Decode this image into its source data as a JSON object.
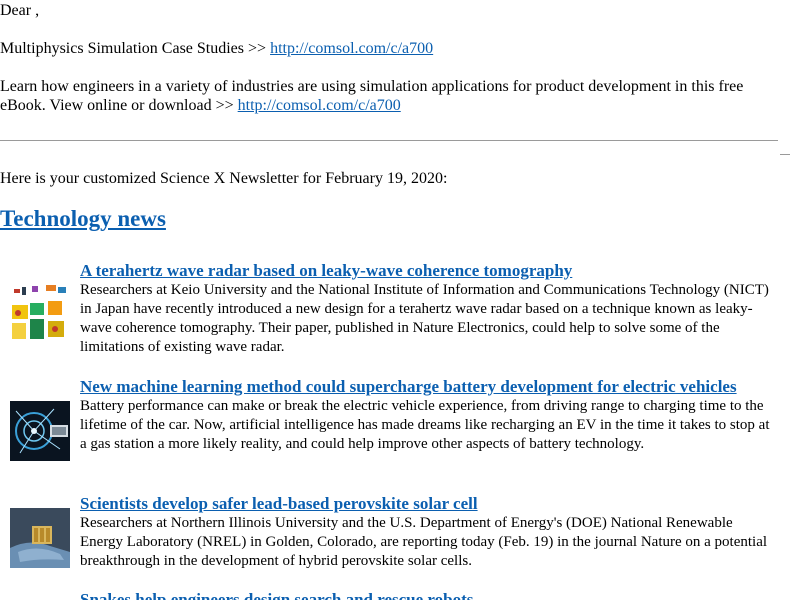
{
  "header": {
    "greeting": "Dear ,",
    "promo_title": "Multiphysics Simulation Case Studies >>",
    "promo_link": "http://comsol.com/c/a700",
    "promo_text": "Learn how engineers in a variety of industries are using simulation applications for product development in this free eBook. View online or download >>",
    "promo_link_2": "http://comsol.com/c/a700"
  },
  "newsletter": {
    "intro": "Here is your customized Science X Newsletter for February 19, 2020:",
    "section_title": "Technology news",
    "articles": [
      {
        "title": "A terahertz wave radar based on leaky-wave coherence tomography",
        "summary": "Researchers at Keio University and the National Institute of Information and Communications Technology (NICT) in Japan have recently introduced a new design for a terahertz wave radar based on a technique known as leaky-wave coherence tomography. Their paper, published in Nature Electronics, could help to solve some of the limitations of existing wave radar.",
        "thumbnail": "radar-diagram-thumbnail"
      },
      {
        "title": "New machine learning method could supercharge battery development for electric vehicles",
        "summary": "Battery performance can make or break the electric vehicle experience, from driving range to charging time to the lifetime of the car. Now, artificial intelligence has made dreams like recharging an EV in the time it takes to stop at a gas station a more likely reality, and could help improve other aspects of battery technology.",
        "thumbnail": "battery-neural-thumbnail"
      },
      {
        "title": "Scientists develop safer lead-based perovskite solar cell",
        "summary": "Researchers at Northern Illinois University and the U.S. Department of Energy's (DOE) National Renewable Energy Laboratory (NREL) in Golden, Colorado, are reporting today (Feb. 19) in the journal Nature on a potential breakthrough in the development of hybrid perovskite solar cells.",
        "thumbnail": "solar-cell-hand-thumbnail"
      },
      {
        "title": "Snakes help engineers design search and rescue robots",
        "summary": "",
        "thumbnail": ""
      }
    ]
  }
}
